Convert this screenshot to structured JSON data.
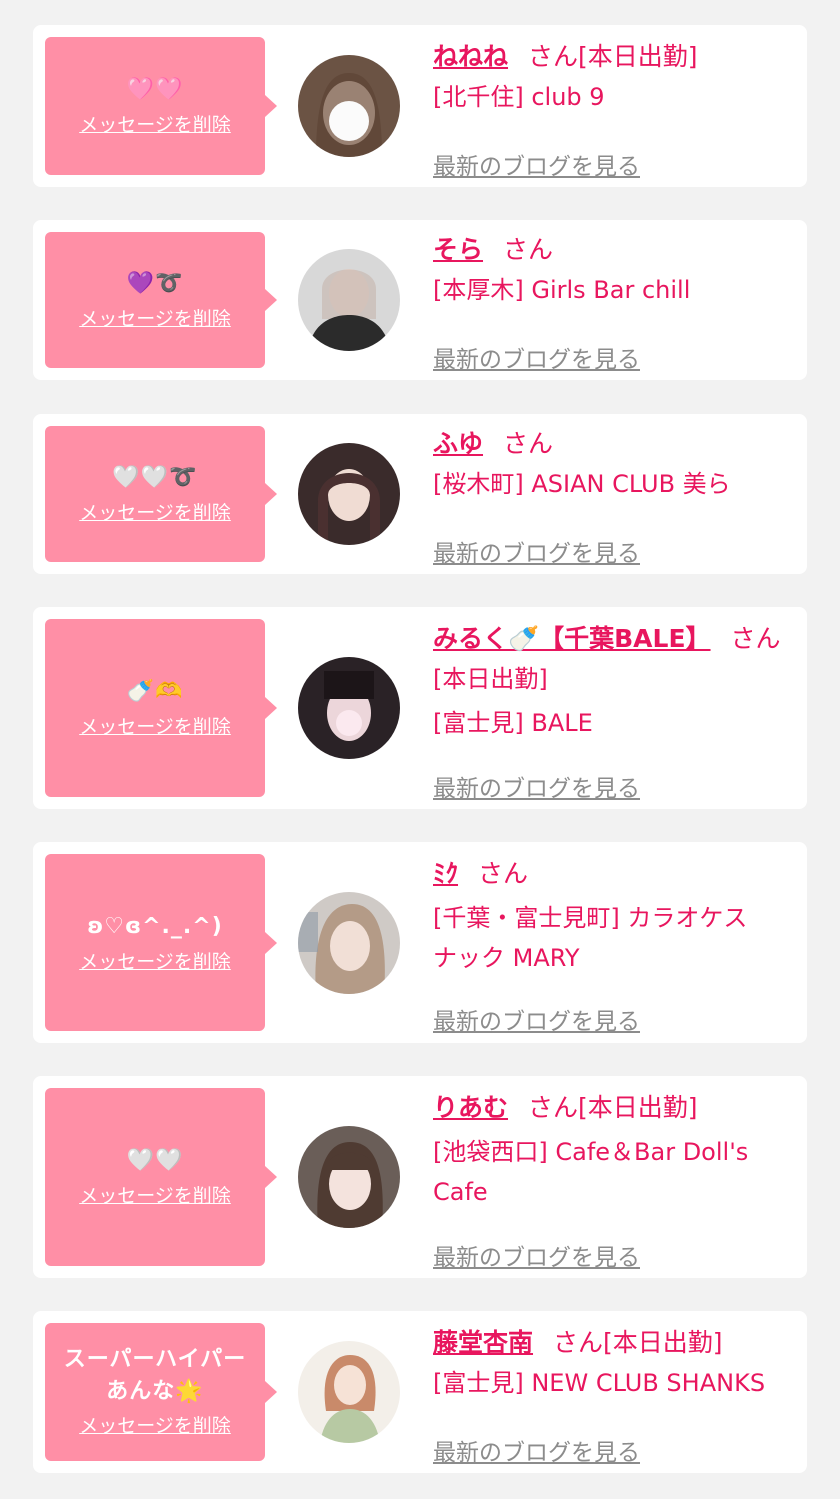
{
  "colors": {
    "background": "#f2f2f2",
    "card": "#ffffff",
    "bubble": "#ff8fa6",
    "accent": "#e8165e",
    "muted": "#8c8c8c"
  },
  "delete_label": "メッセージを削除",
  "blog_label": "最新のブログを見る",
  "cards": [
    {
      "message": "🩷🩷",
      "name": "ねねね",
      "suffix": "さん[本日出勤]",
      "shop_lines": [
        "[北千住] club 9"
      ]
    },
    {
      "message": "💜➰",
      "name": "そら",
      "suffix": "さん",
      "shop_lines": [
        "[本厚木] Girls Bar chill"
      ]
    },
    {
      "message": "🤍🤍➰",
      "name": "ふゆ",
      "suffix": "さん",
      "shop_lines": [
        "[桜木町] ASIAN CLUB 美ら"
      ]
    },
    {
      "message": "🍼🫶",
      "name": "みるく🍼【千葉BALE】",
      "suffix": "さん",
      "shop_lines": [
        "[本日出勤]",
        "[富士見] BALE"
      ]
    },
    {
      "message": "ʚ♡ɞ^._.^)",
      "name": "ﾐｸ",
      "suffix": "さん",
      "shop_lines": [
        "[千葉・富士見町] カラオケス",
        "ナック MARY"
      ]
    },
    {
      "message": "🤍🤍",
      "name": "りあむ",
      "suffix": "さん[本日出勤]",
      "shop_lines": [
        "[池袋西口] Cafe＆Bar Doll's",
        "Cafe"
      ]
    },
    {
      "message": "スーパーハイパー\nあんな🌟",
      "name": "藤堂杏南",
      "suffix": "さん[本日出勤]",
      "shop_lines": [
        "[富士見] NEW CLUB SHANKS"
      ]
    }
  ]
}
